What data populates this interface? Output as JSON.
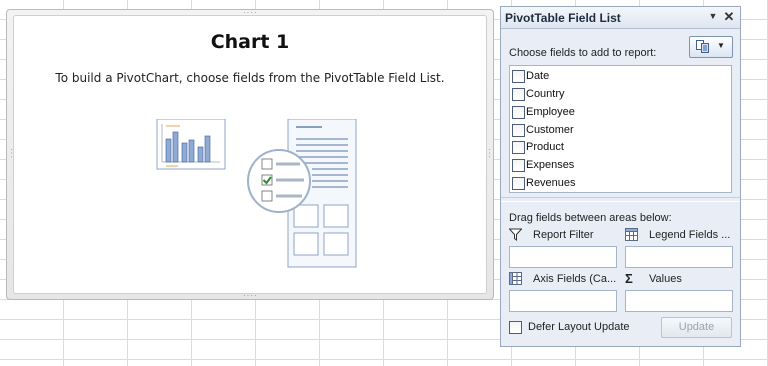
{
  "chart": {
    "title": "Chart 1",
    "message": "To build a PivotChart, choose fields from the PivotTable Field List."
  },
  "field_list": {
    "title": "PivotTable Field List",
    "choose_label": "Choose fields to add to report:",
    "fields": [
      {
        "label": "Date",
        "checked": false
      },
      {
        "label": "Country",
        "checked": false
      },
      {
        "label": "Employee",
        "checked": false
      },
      {
        "label": "Customer",
        "checked": false
      },
      {
        "label": "Product",
        "checked": false
      },
      {
        "label": "Expenses",
        "checked": false
      },
      {
        "label": "Revenues",
        "checked": false
      }
    ],
    "drag_label": "Drag fields between areas below:",
    "areas": {
      "report_filter": "Report Filter",
      "legend_fields": "Legend Fields ...",
      "axis_fields": "Axis Fields (Ca...",
      "values": "Values"
    },
    "defer_label": "Defer Layout Update",
    "update_label": "Update"
  },
  "icons": {
    "filter": "funnel-icon",
    "legend": "legend-grid-icon",
    "axis": "axis-grid-icon",
    "values": "sigma-icon",
    "layout": "field-list-layout-icon",
    "close": "close-icon",
    "dropdown": "chevron-down-icon"
  },
  "colors": {
    "pane_bg": "#e9eef6",
    "accent": "#4a6fa5",
    "check_green": "#2e8b2e"
  }
}
